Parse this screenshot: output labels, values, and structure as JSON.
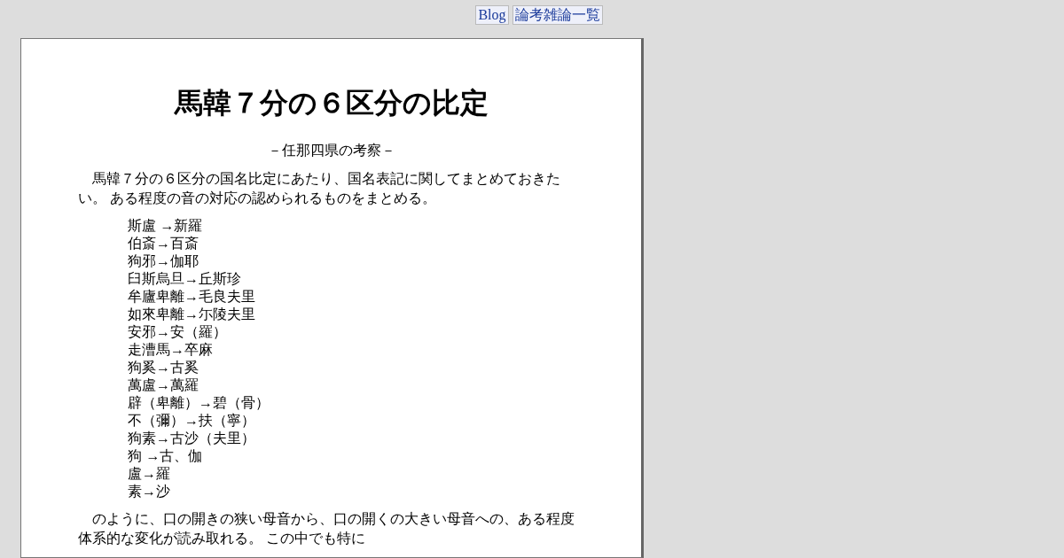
{
  "nav_links": [
    "Blog",
    "論考雑論一覧"
  ],
  "title": "馬韓７分の６区分の比定",
  "subtitle": "－任那四県の考察－",
  "intro": "馬韓７分の６区分の国名比定にあたり、国名表記に関してまとめておきたい。 ある程度の音の対応の認められるものをまとめる。",
  "correspondences": [
    "斯盧 →新羅",
    "伯斎→百斎",
    "狗邪→伽耶",
    "臼斯烏旦→丘斯珍",
    "牟廬卑離→毛良夫里",
    "如來卑離→尓陵夫里",
    "安邪→安（羅）",
    "走漕馬→卒麻",
    "狗奚→古奚",
    "萬盧→萬羅",
    "辟（卑離）→碧（骨）",
    "不（彌）→扶（寧）",
    "狗素→古沙（夫里）",
    "狗 →古、伽",
    "盧→羅",
    "素→沙"
  ],
  "conclusion": "のように、口の開きの狭い母音から、口の開くの大きい母音への、ある程度体系的な変化が読み取れる。 この中でも特に"
}
